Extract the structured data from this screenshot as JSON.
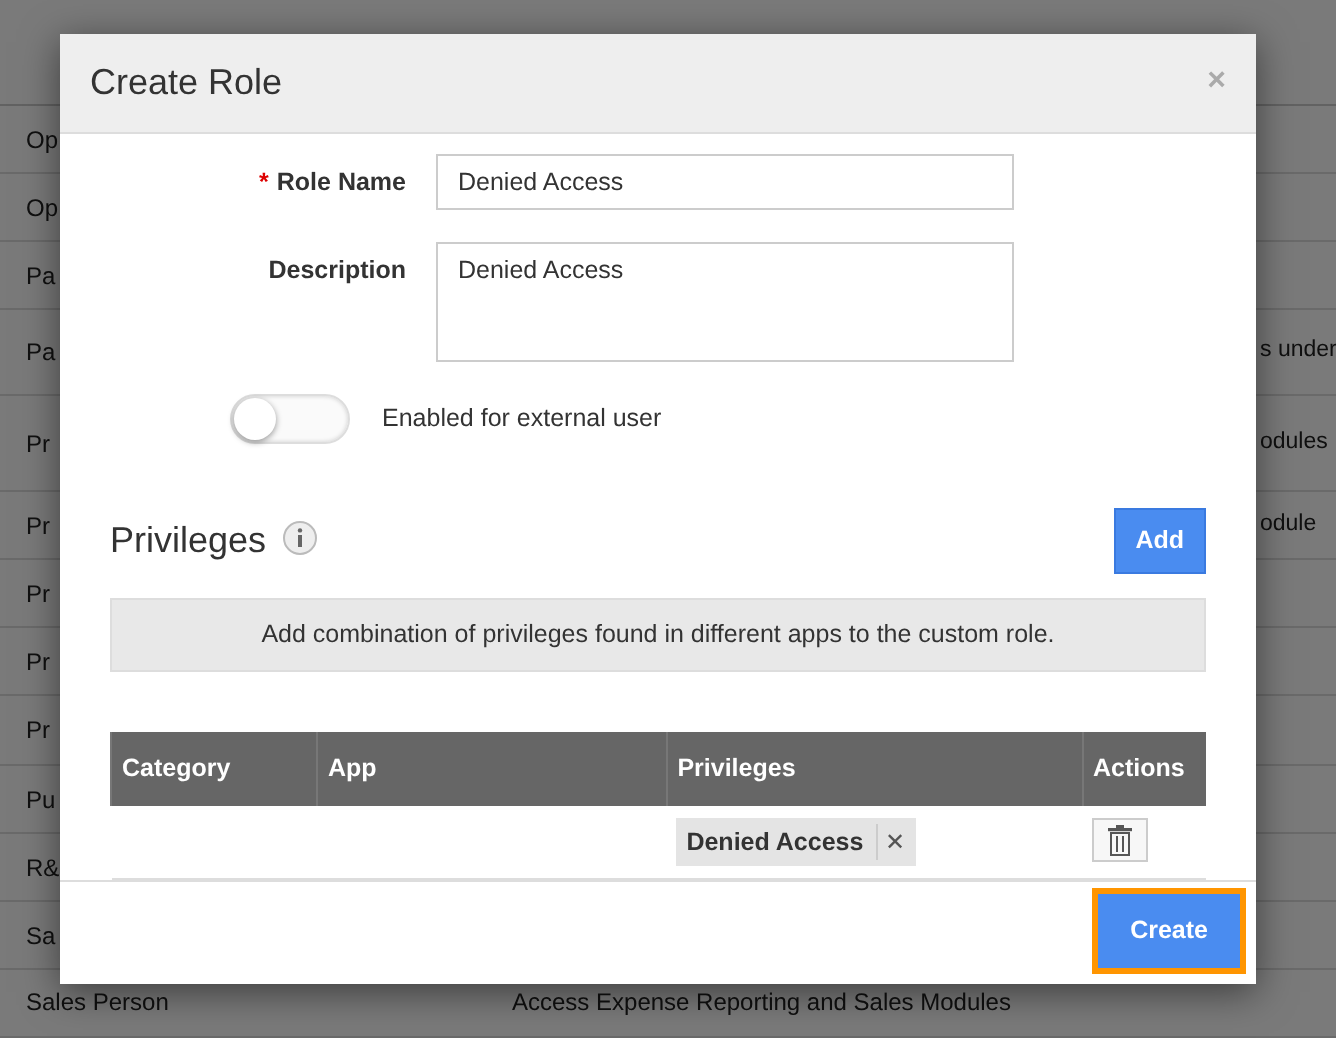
{
  "background_list": {
    "rows": [
      {
        "column_1": "Op"
      },
      {
        "column_1": "Op"
      },
      {
        "column_1": "Pa"
      },
      {
        "column_1": "Pa",
        "column_2": "s under"
      },
      {
        "column_1": "Pr",
        "column_2": "odules"
      },
      {
        "column_1": "Pr",
        "column_2": "odule"
      },
      {
        "column_1": "Pr"
      },
      {
        "column_1": "Pr"
      },
      {
        "column_1": "Pr"
      },
      {
        "column_1": "Pu"
      },
      {
        "column_1": "R&"
      },
      {
        "column_1": "Sa"
      },
      {
        "column_1": "Sales Person",
        "column_2": "Access Expense Reporting and Sales Modules"
      }
    ]
  },
  "modal": {
    "title": "Create Role",
    "close": "×",
    "fields": [
      {
        "kind": "input",
        "label": "Role Name",
        "required_mark": "*",
        "value": "Denied Access"
      },
      {
        "kind": "textarea",
        "label": "Description",
        "value": "Denied Access"
      }
    ],
    "toggle": {
      "label": "Enabled for external user",
      "on": false
    },
    "privileges": {
      "heading": "Privileges",
      "add_button": "Add",
      "info": "Add combination of privileges found in different apps to the custom role.",
      "table": {
        "columns": [
          "Category",
          "App",
          "Privileges",
          "Actions"
        ],
        "rows": [
          {
            "privileges": [
              {
                "label": "Denied Access",
                "remove": "✕"
              }
            ]
          }
        ]
      }
    },
    "create_button": {
      "label": "Create",
      "focused": true
    }
  }
}
